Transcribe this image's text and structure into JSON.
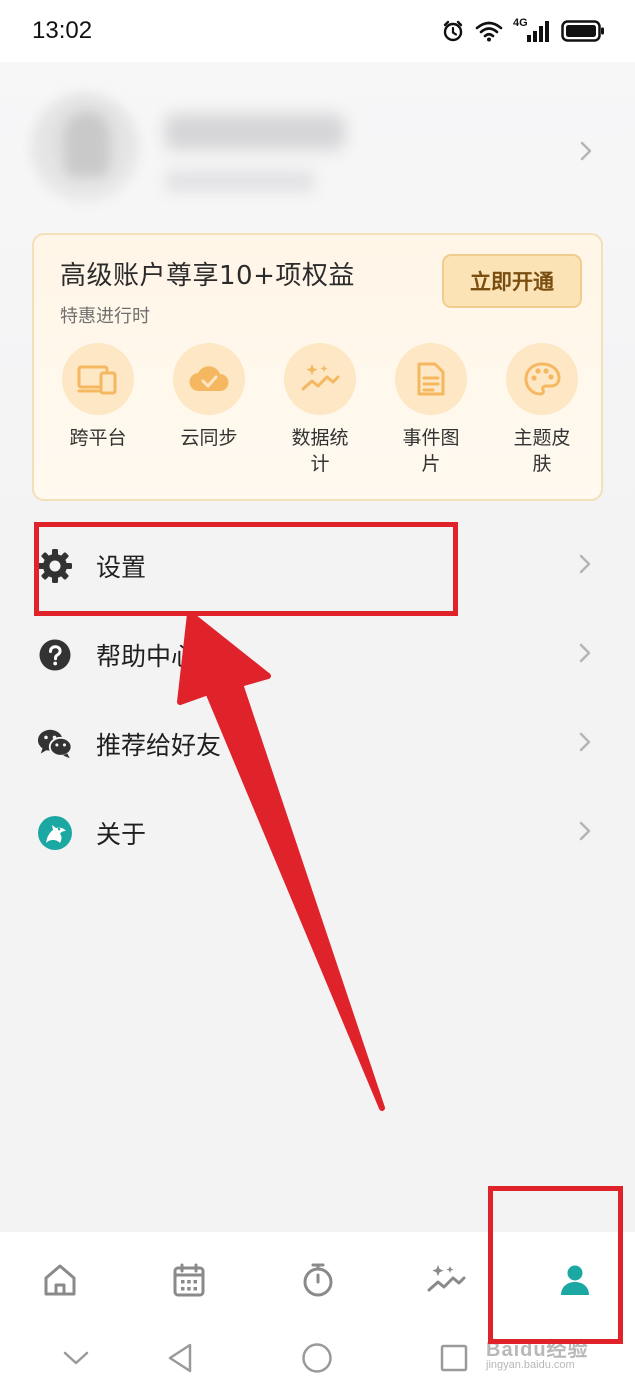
{
  "status_bar": {
    "time": "13:02",
    "network_label": "4G",
    "icons": [
      "alarm-icon",
      "wifi-icon",
      "signal-icon",
      "battery-icon"
    ]
  },
  "profile": {
    "name": "",
    "subtitle": "",
    "avatar_icon": "avatar-icon"
  },
  "vip": {
    "title": "高级账户尊享10+项权益",
    "subtitle": "特惠进行时",
    "button_label": "立即开通",
    "benefits": [
      {
        "label": "跨平台",
        "icon": "devices-icon"
      },
      {
        "label": "云同步",
        "icon": "cloud-check-icon"
      },
      {
        "label": "数据统计",
        "icon": "sparkle-chart-icon"
      },
      {
        "label": "事件图片",
        "icon": "document-icon"
      },
      {
        "label": "主题皮肤",
        "icon": "palette-icon"
      }
    ]
  },
  "menu": [
    {
      "label": "设置",
      "icon": "gear-icon"
    },
    {
      "label": "帮助中心",
      "icon": "help-icon"
    },
    {
      "label": "推荐给好友",
      "icon": "wechat-icon"
    },
    {
      "label": "关于",
      "icon": "app-logo-icon"
    }
  ],
  "bottom_nav": {
    "items": [
      "home-icon",
      "calendar-icon",
      "timer-icon",
      "stats-icon",
      "profile-icon"
    ],
    "active_index": 4,
    "active_color": "#1ba7a2",
    "inactive_color": "#8a8a8a"
  },
  "watermark": {
    "main": "Baidu经验",
    "sub": "jingyan.baidu.com"
  },
  "colors": {
    "annotation_red": "#e0222b",
    "vip_accent": "#f5b861"
  }
}
